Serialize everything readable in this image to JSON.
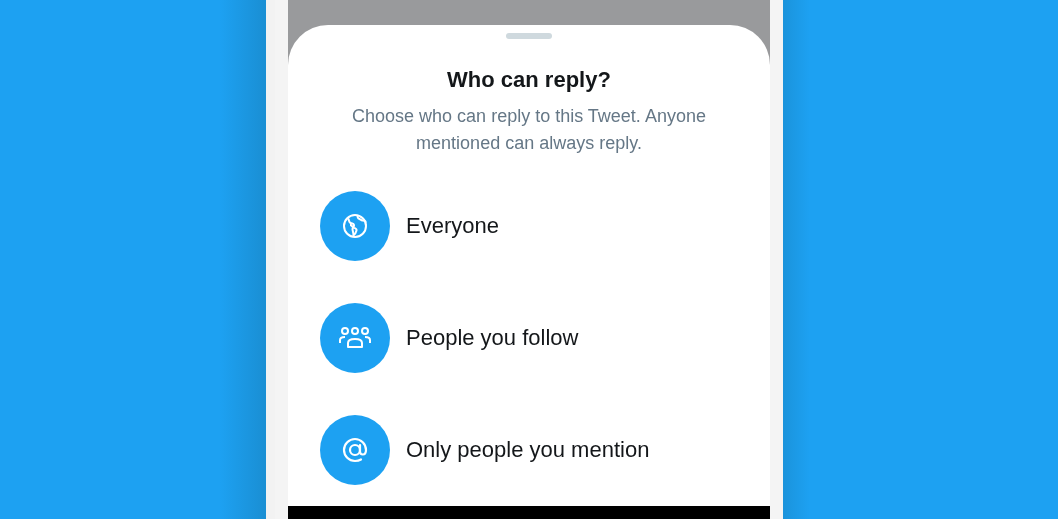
{
  "sheet": {
    "title": "Who can reply?",
    "subtitle": "Choose who can reply to this Tweet. Anyone mentioned can always reply.",
    "options": [
      {
        "kind": "globe",
        "label": "Everyone"
      },
      {
        "kind": "people",
        "label": "People you follow"
      },
      {
        "kind": "mention",
        "label": "Only people you mention"
      }
    ]
  }
}
